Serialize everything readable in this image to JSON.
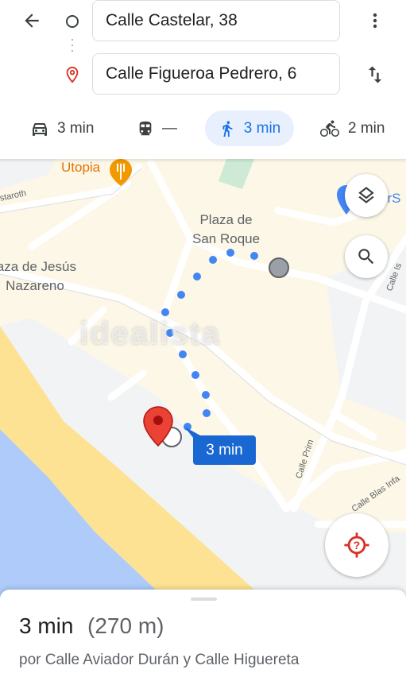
{
  "search": {
    "origin_value": "Calle Castelar, 38",
    "destination_value": "Calle Figueroa Pedrero, 6"
  },
  "icons": {
    "back": "arrow-left-icon",
    "origin": "origin-circle-icon",
    "destination": "location-pin-icon",
    "more": "more-vert-icon",
    "swap": "swap-vertical-icon",
    "layers": "layers-icon",
    "search": "search-icon",
    "recenter": "location-target-icon"
  },
  "modes": {
    "car": {
      "icon": "car-icon",
      "label": "3 min"
    },
    "transit": {
      "icon": "train-icon",
      "label": "—"
    },
    "walk": {
      "icon": "walking-icon",
      "label": "3 min",
      "selected": true
    },
    "bike": {
      "icon": "bicycle-icon",
      "label": "2 min"
    }
  },
  "map": {
    "poi_utopia": "Utopia",
    "place_san_roque": "Plaza de\nSan Roque",
    "place_jesus_nazareno": "laza de Jesús\nNazareno",
    "street_estaroth": "staroth",
    "street_calle_prim": "Calle Prim",
    "street_calle_blas": "Calle Blas Infa",
    "street_calle_right": "Calle Is",
    "poi_right_partial": "erS",
    "route_chip": "3 min",
    "watermark": "idealista"
  },
  "colors": {
    "accent": "#1a73e8",
    "route_dots": "#4285f4",
    "destination_pin": "#ea4335",
    "sea": "#aecbfa",
    "beach": "#fde293",
    "park": "#ceead6"
  },
  "sheet": {
    "time": "3 min",
    "distance": "(270 m)",
    "via": "por Calle Aviador Durán y Calle Higuereta"
  }
}
